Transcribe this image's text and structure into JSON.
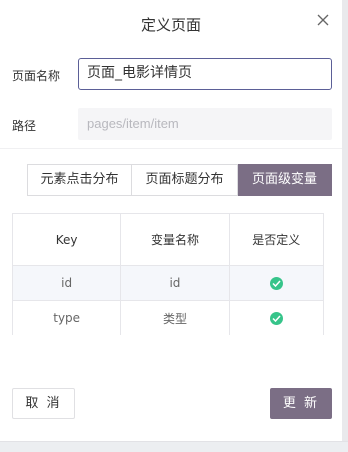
{
  "dialog": {
    "title": "定义页面",
    "close_icon": "close-icon"
  },
  "form": {
    "name_label": "页面名称",
    "name_value": "页面_电影详情页",
    "path_label": "路径",
    "path_placeholder": "pages/item/item"
  },
  "tabs": [
    {
      "label": "元素点击分布",
      "active": false
    },
    {
      "label": "页面标题分布",
      "active": false
    },
    {
      "label": "页面级变量",
      "active": true
    }
  ],
  "table": {
    "headers": [
      "Key",
      "变量名称",
      "是否定义"
    ],
    "rows": [
      {
        "key": "id",
        "name": "id",
        "defined": true
      },
      {
        "key": "type",
        "name": "类型",
        "defined": true
      }
    ]
  },
  "buttons": {
    "cancel": "取 消",
    "update": "更 新"
  },
  "colors": {
    "accent": "#7b6e85",
    "input_border": "#5b5f97",
    "check": "#36c48a"
  }
}
